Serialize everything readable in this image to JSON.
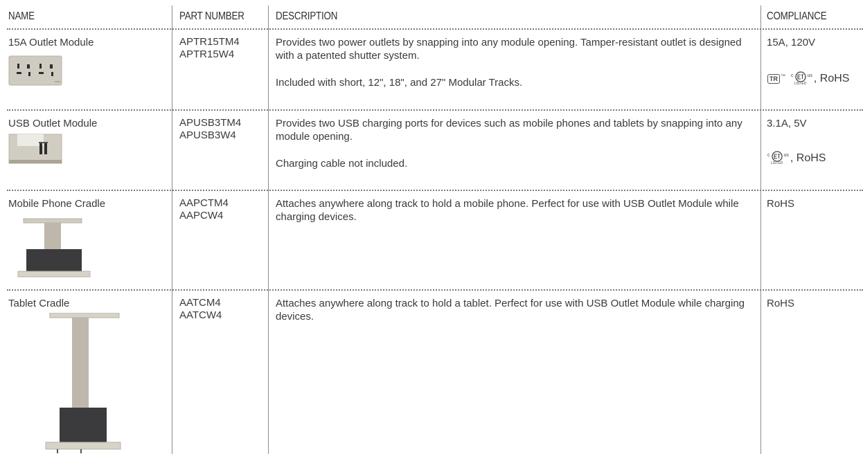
{
  "headers": {
    "name": "NAME",
    "part_number": "PART NUMBER",
    "description": "DESCRIPTION",
    "compliance": "COMPLIANCE"
  },
  "rows": [
    {
      "name": "15A Outlet Module",
      "part_numbers": [
        "APTR15TM4",
        "APTR15W4"
      ],
      "description": [
        "Provides two power outlets by snapping into any module opening. Tamper-resistant outlet is designed with a patented shutter system.",
        "Included with short, 12\", 18\", and 27\" Modular Tracks."
      ],
      "compliance": "15A, 120V",
      "certs": ", RoHS",
      "cert_marks": {
        "tr": "TR",
        "tm": "™",
        "c": "c",
        "us": "us",
        "listed": "LISTED"
      }
    },
    {
      "name": "USB Outlet Module",
      "part_numbers": [
        "APUSB3TM4",
        "APUSB3W4"
      ],
      "description": [
        "Provides two USB charging ports for devices such as mobile phones and tablets by snapping into any module opening.",
        "Charging cable not included."
      ],
      "compliance": "3.1A, 5V",
      "certs": ", RoHS",
      "cert_marks": {
        "c": "c",
        "us": "us",
        "listed": "LISTED"
      }
    },
    {
      "name": "Mobile Phone Cradle",
      "part_numbers": [
        "AAPCTM4",
        "AAPCW4"
      ],
      "description": [
        "Attaches anywhere along track to hold a mobile phone. Perfect for use with USB Outlet Module while charging devices."
      ],
      "compliance": "RoHS"
    },
    {
      "name": "Tablet Cradle",
      "part_numbers": [
        "AATCM4",
        "AATCW4"
      ],
      "description": [
        "Attaches anywhere along track to hold a tablet. Perfect for use with USB Outlet Module while charging devices."
      ],
      "compliance": "RoHS"
    }
  ]
}
